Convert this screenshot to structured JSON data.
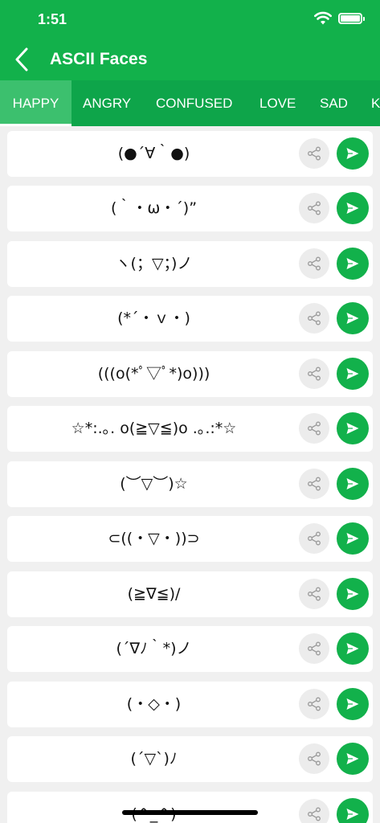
{
  "status": {
    "time": "1:51"
  },
  "header": {
    "title": "ASCII Faces"
  },
  "tabs": [
    {
      "label": "HAPPY",
      "active": true
    },
    {
      "label": "ANGRY"
    },
    {
      "label": "CONFUSED"
    },
    {
      "label": "LOVE"
    },
    {
      "label": "SAD"
    },
    {
      "label": "K"
    }
  ],
  "faces": [
    "(●´∀｀●)",
    "(｀・ω・´)”",
    "ヽ(；▽；)ノ",
    "(*´・ｖ・)",
    "(((o(*ﾟ▽ﾟ*)o)))",
    "☆*:.｡. o(≧▽≦)o .｡.:*☆",
    "(︶▽︶)☆",
    "⊂((・▽・))⊃",
    "(≧∇≦)/",
    "(´∇ﾉ｀*)ノ",
    "(・◇・)",
    "(´▽`)ﾉ",
    "(^_^)"
  ],
  "colors": {
    "primary": "#12b14b",
    "tabbar": "#0ea54a",
    "active_tab": "#3cc06e"
  },
  "icons": {
    "back": "chevron-left-icon",
    "share": "share-icon",
    "send": "send-icon"
  }
}
